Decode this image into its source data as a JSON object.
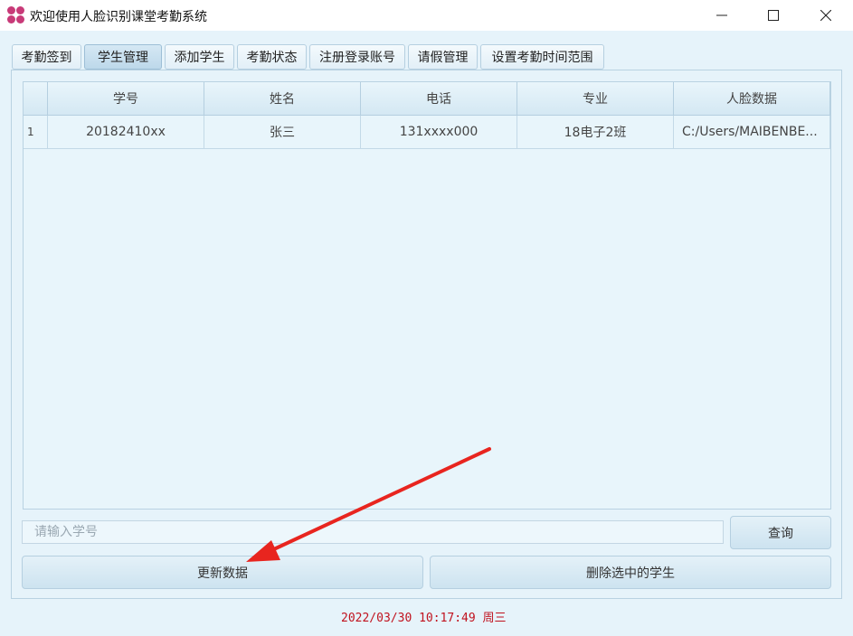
{
  "window": {
    "title": "欢迎使用人脸识别课堂考勤系统",
    "logo_color": "#c83a78"
  },
  "tabs": [
    {
      "label": "考勤签到",
      "active": false
    },
    {
      "label": "学生管理",
      "active": true
    },
    {
      "label": "添加学生",
      "active": false
    },
    {
      "label": "考勤状态",
      "active": false
    },
    {
      "label": "注册登录账号",
      "active": false
    },
    {
      "label": "请假管理",
      "active": false
    },
    {
      "label": "设置考勤时间范围",
      "active": false
    }
  ],
  "table": {
    "columns": [
      "学号",
      "姓名",
      "电话",
      "专业",
      "人脸数据"
    ],
    "rows": [
      {
        "index": "1",
        "cells": [
          "20182410xx",
          "张三",
          "131xxxx000",
          "18电子2班",
          "C:/Users/MAIBENBE..."
        ]
      }
    ]
  },
  "search": {
    "placeholder": "请输入学号",
    "value": ""
  },
  "buttons": {
    "query": "查询",
    "refresh": "更新数据",
    "delete_selected": "删除选中的学生"
  },
  "status": {
    "datetime": "2022/03/30 10:17:49 周三",
    "datetime_color": "#c0121e"
  },
  "annotation": {
    "arrow_color": "#e8251f"
  }
}
